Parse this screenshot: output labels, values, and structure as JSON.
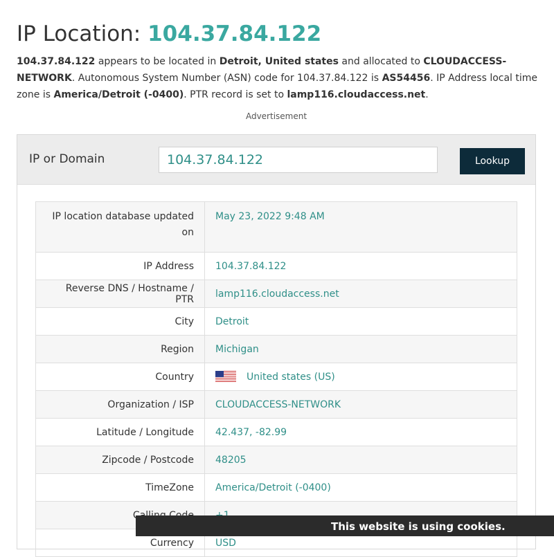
{
  "title": {
    "prefix": "IP Location:",
    "ip": "104.37.84.122"
  },
  "intro": {
    "ip": "104.37.84.122",
    "t1": " appears to be located in ",
    "location": "Detroit, United states",
    "t2": " and allocated to ",
    "org": "CLOUDACCESS-NETWORK",
    "t3": ". Autonomous System Number (ASN) code for 104.37.84.122 is ",
    "asn": "AS54456",
    "t4": ". IP Address local time zone is ",
    "tz": "America/Detroit (-0400)",
    "t5": ". PTR record is set to ",
    "ptr": "lamp116.cloudaccess.net",
    "t6": "."
  },
  "advertisement_label": "Advertisement",
  "search": {
    "label": "IP or Domain",
    "value": "104.37.84.122",
    "button_label": "Lookup"
  },
  "table": [
    {
      "key": "IP location database updated on",
      "value": "May 23, 2022 9:48 AM"
    },
    {
      "key": "IP Address",
      "value": "104.37.84.122"
    },
    {
      "key": "Reverse DNS / Hostname / PTR",
      "value": "lamp116.cloudaccess.net"
    },
    {
      "key": "City",
      "value": "Detroit"
    },
    {
      "key": "Region",
      "value": "Michigan"
    },
    {
      "key": "Country",
      "value": "United states (US)"
    },
    {
      "key": "Organization / ISP",
      "value": "CLOUDACCESS-NETWORK"
    },
    {
      "key": "Latitude / Longitude",
      "value": "42.437, -82.99"
    },
    {
      "key": "Zipcode / Postcode",
      "value": "48205"
    },
    {
      "key": "TimeZone",
      "value": "America/Detroit (-0400)"
    },
    {
      "key": "Calling Code",
      "value": "+1"
    },
    {
      "key": "Currency",
      "value": "USD"
    }
  ],
  "cookie_banner": {
    "text": "This website is using cookies."
  },
  "colors": {
    "accent": "#3aa8a0",
    "button": "#0d2b3a",
    "banner": "#2b2b2b"
  }
}
